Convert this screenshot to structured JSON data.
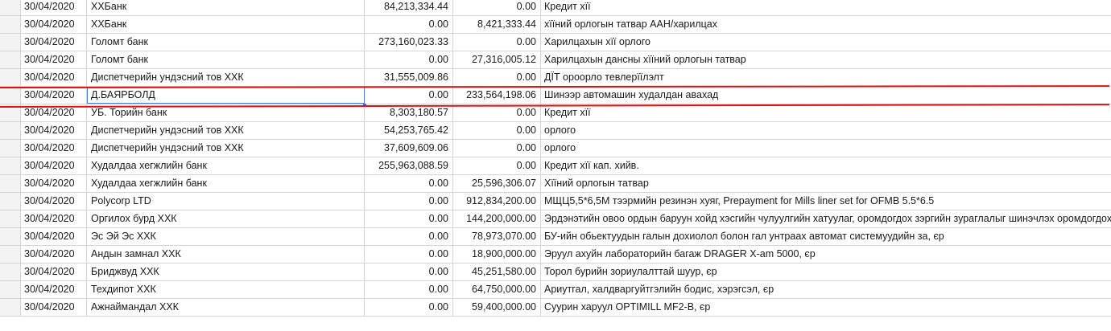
{
  "rows": [
    {
      "date": "30/04/2020",
      "party": "ХХБанк",
      "debit": "84,213,334.44",
      "credit": "0.00",
      "desc": "Кредит хїї"
    },
    {
      "date": "30/04/2020",
      "party": "ХХБанк",
      "debit": "0.00",
      "credit": "8,421,333.44",
      "desc": "хїїний орлогын татвар ААН/харилцах"
    },
    {
      "date": "30/04/2020",
      "party": "Голомт банк",
      "debit": "273,160,023.33",
      "credit": "0.00",
      "desc": "Харилцахын хїї орлого"
    },
    {
      "date": "30/04/2020",
      "party": "Голомт банк",
      "debit": "0.00",
      "credit": "27,316,005.12",
      "desc": "Харилцахын дансны хїїний орлогын татвар"
    },
    {
      "date": "30/04/2020",
      "party": "Диспетчерийн ундэсний тов ХХК",
      "debit": "31,555,009.86",
      "credit": "0.00",
      "desc": "ДЇТ ороорло тевлерїїлэлт"
    },
    {
      "date": "30/04/2020",
      "party": "Д.БАЯРБОЛД",
      "debit": "0.00",
      "credit": "233,564,198.06",
      "desc": "Шинээр автомашин худалдан авахад"
    },
    {
      "date": "30/04/2020",
      "party": "УБ. Торийн банк",
      "debit": "8,303,180.57",
      "credit": "0.00",
      "desc": "Кредит хїї"
    },
    {
      "date": "30/04/2020",
      "party": "Диспетчерийн ундэсний тов ХХК",
      "debit": "54,253,765.42",
      "credit": "0.00",
      "desc": "орлого"
    },
    {
      "date": "30/04/2020",
      "party": "Диспетчерийн ундэсний тов ХХК",
      "debit": "37,609,609.06",
      "credit": "0.00",
      "desc": "орлого"
    },
    {
      "date": "30/04/2020",
      "party": "Худалдаа хегжлийн банк",
      "debit": "255,963,088.59",
      "credit": "0.00",
      "desc": "Кредит хїї кап. хийв."
    },
    {
      "date": "30/04/2020",
      "party": "Худалдаа хегжлийн банк",
      "debit": "0.00",
      "credit": "25,596,306.07",
      "desc": "Хїїний орлогын татвар"
    },
    {
      "date": "30/04/2020",
      "party": "Polycorp LTD",
      "debit": "0.00",
      "credit": "912,834,200.00",
      "desc": "МЩЦ5,5*6,5М тээрмийн резинэн хуяг, Prepayment for Mills liner set for OFMB 5.5*6.5"
    },
    {
      "date": "30/04/2020",
      "party": "Оргилох бурд ХХК",
      "debit": "0.00",
      "credit": "144,200,000.00",
      "desc": "Эрдэнэтийн овоо ордын баруун хойд хэсгийн чулуулгийн хатуулаг, оромдогдох зэргийн зураглалыг шинэчлэх оромдогдох зэргийг тод"
    },
    {
      "date": "30/04/2020",
      "party": "Эс Эй Эс ХХК",
      "debit": "0.00",
      "credit": "78,973,070.00",
      "desc": "БУ-ийн обьектуудын галын дохиолол болон гал унтраах автомат системуудийн за, єр"
    },
    {
      "date": "30/04/2020",
      "party": "Андын замнал ХХК",
      "debit": "0.00",
      "credit": "18,900,000.00",
      "desc": "Эруул ахуйн лабораторийн багаж DRAGER X-am 5000, єр"
    },
    {
      "date": "30/04/2020",
      "party": "Бриджвуд ХХК",
      "debit": "0.00",
      "credit": "45,251,580.00",
      "desc": "Торол бурийн зориулалттай шуур, єр"
    },
    {
      "date": "30/04/2020",
      "party": "Техдипот ХХК",
      "debit": "0.00",
      "credit": "64,750,000.00",
      "desc": "Ариутгал, халдваргуйтгэлийн бодис, хэрэгсэл, єр"
    },
    {
      "date": "30/04/2020",
      "party": "Ажнаймандал ХХК",
      "debit": "0.00",
      "credit": "59,400,000.00",
      "desc": "Суурин харуул OPTIMILL MF2-B, єр"
    }
  ],
  "selected_row": 5,
  "colors": {
    "grid": "#d4d4d4",
    "selection": "#4a7fd8",
    "annotation": "#e01010"
  }
}
